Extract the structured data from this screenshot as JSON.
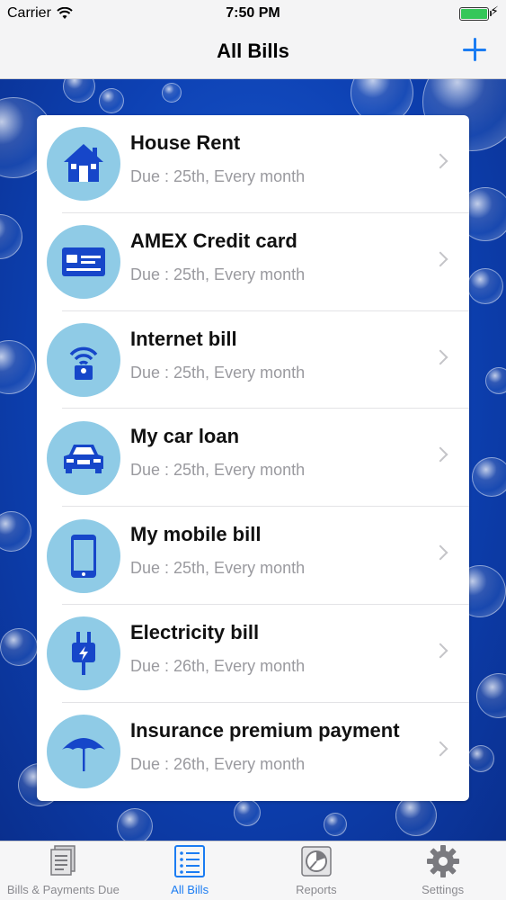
{
  "status": {
    "carrier": "Carrier",
    "time": "7:50 PM"
  },
  "nav": {
    "title": "All Bills",
    "add_icon": "plus-icon"
  },
  "bills": [
    {
      "name": "House Rent",
      "due": "Due : 25th, Every month",
      "icon": "house-icon"
    },
    {
      "name": "AMEX Credit card",
      "due": "Due : 25th, Every month",
      "icon": "credit-card-icon"
    },
    {
      "name": "Internet bill",
      "due": "Due : 25th, Every month",
      "icon": "wifi-router-icon"
    },
    {
      "name": "My car loan",
      "due": "Due : 25th, Every month",
      "icon": "car-icon"
    },
    {
      "name": "My mobile bill",
      "due": "Due : 25th, Every month",
      "icon": "mobile-phone-icon"
    },
    {
      "name": "Electricity bill",
      "due": "Due : 26th, Every month",
      "icon": "electric-plug-icon"
    },
    {
      "name": "Insurance premium payment",
      "due": "Due : 26th, Every month",
      "icon": "umbrella-icon"
    }
  ],
  "tabs": [
    {
      "label": "Bills & Payments Due",
      "icon": "documents-icon",
      "active": false
    },
    {
      "label": "All Bills",
      "icon": "list-icon",
      "active": true
    },
    {
      "label": "Reports",
      "icon": "pie-chart-icon",
      "active": false
    },
    {
      "label": "Settings",
      "icon": "gear-icon",
      "active": false
    }
  ],
  "colors": {
    "accent": "#1b7cf2",
    "icon_circle": "#8fcbe6",
    "icon_fill": "#1646c9",
    "background": "#0d41b3"
  }
}
